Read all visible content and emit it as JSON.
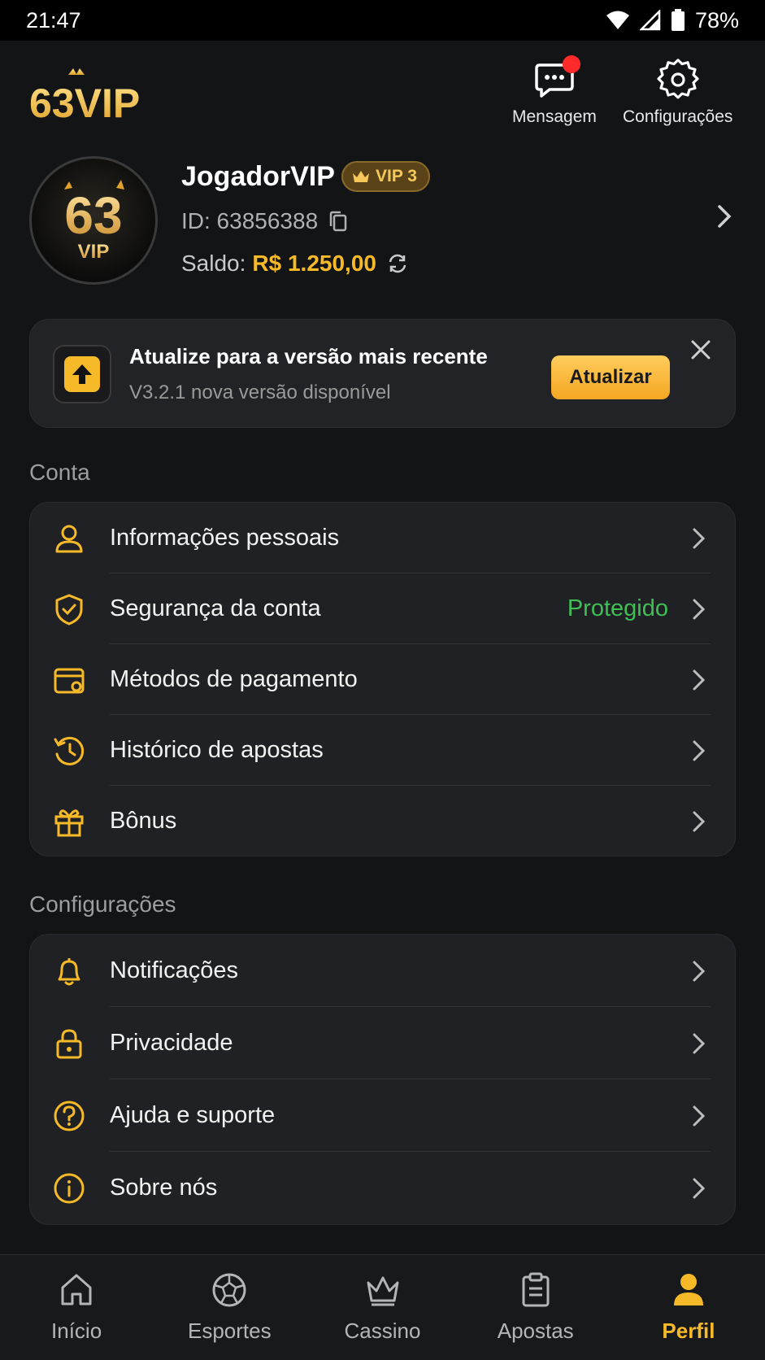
{
  "status_bar": {
    "time": "21:47",
    "battery": "78%"
  },
  "header": {
    "logo_text": "63VIP",
    "message_label": "Mensagem",
    "settings_label": "Configurações"
  },
  "profile": {
    "avatar_text_top": "63",
    "avatar_text_bottom": "VIP",
    "username": "JogadorVIP",
    "vip_badge": "VIP 3",
    "id_text": "ID: 63856388",
    "balance_label": "Saldo:",
    "balance_amount": "R$ 1.250,00"
  },
  "update_banner": {
    "title": "Atualize para a versão mais recente",
    "subtitle": "V3.2.1 nova versão disponível",
    "button_label": "Atualizar"
  },
  "account_section": {
    "title": "Conta",
    "items": [
      {
        "label": "Informações pessoais",
        "icon": "user-icon",
        "value": ""
      },
      {
        "label": "Segurança da conta",
        "icon": "shield-icon",
        "value": "Protegido"
      },
      {
        "label": "Métodos de pagamento",
        "icon": "wallet-icon",
        "value": ""
      },
      {
        "label": "Histórico de apostas",
        "icon": "history-icon",
        "value": ""
      },
      {
        "label": "Bônus",
        "icon": "gift-icon",
        "value": ""
      }
    ]
  },
  "settings_section": {
    "title": "Configurações",
    "items": [
      {
        "label": "Notificações",
        "icon": "bell-icon"
      },
      {
        "label": "Privacidade",
        "icon": "lock-icon"
      },
      {
        "label": "Ajuda e suporte",
        "icon": "help-icon"
      },
      {
        "label": "Sobre nós",
        "icon": "info-icon"
      }
    ]
  },
  "bottom_nav": {
    "items": [
      {
        "label": "Início",
        "icon": "home-icon",
        "active": false
      },
      {
        "label": "Esportes",
        "icon": "soccer-ball-icon",
        "active": false
      },
      {
        "label": "Cassino",
        "icon": "crown-icon",
        "active": false
      },
      {
        "label": "Apostas",
        "icon": "clipboard-icon",
        "active": false
      },
      {
        "label": "Perfil",
        "icon": "person-icon",
        "active": true
      }
    ]
  },
  "colors": {
    "accent": "#f6b928",
    "background": "#131416",
    "card": "#202124",
    "success": "#3fbf54",
    "notification": "#ff2b2b"
  }
}
